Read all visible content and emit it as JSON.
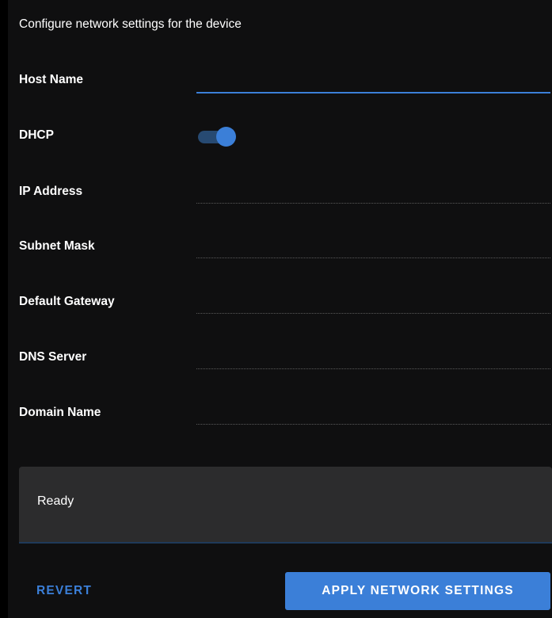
{
  "header": {
    "title": "Configure network settings for the device"
  },
  "fields": {
    "host_name": {
      "label": "Host Name",
      "value": ""
    },
    "dhcp": {
      "label": "DHCP",
      "enabled": true
    },
    "ip_address": {
      "label": "IP Address",
      "value": ""
    },
    "subnet_mask": {
      "label": "Subnet Mask",
      "value": ""
    },
    "default_gateway": {
      "label": "Default Gateway",
      "value": ""
    },
    "dns_server": {
      "label": "DNS Server",
      "value": ""
    },
    "domain_name": {
      "label": "Domain Name",
      "value": ""
    }
  },
  "status": {
    "text": "Ready"
  },
  "actions": {
    "revert_label": "REVERT",
    "apply_label": "APPLY NETWORK SETTINGS"
  },
  "colors": {
    "accent": "#3b7fd8",
    "background": "#0f0f10",
    "status_background": "#2c2c2d"
  }
}
